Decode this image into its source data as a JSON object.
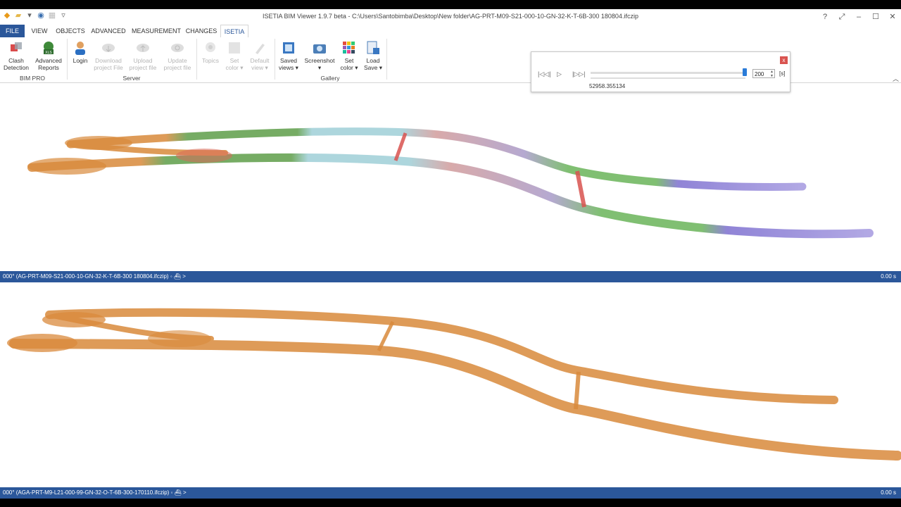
{
  "app": {
    "title": "ISETIA BIM Viewer 1.9.7 beta - C:\\Users\\Santobimba\\Desktop\\New folder\\AG-PRT-M09-S21-000-10-GN-32-K-T-6B-300 180804.ifczip",
    "window_buttons": [
      "?",
      "⤢",
      "–",
      "☐",
      "✕"
    ]
  },
  "tabs": [
    "FILE",
    "VIEW",
    "OBJECTS",
    "ADVANCED",
    "MEASUREMENT",
    "CHANGES",
    "ISETIA"
  ],
  "ribbon": {
    "groups": [
      "BIM PRO",
      "Server",
      "Gallery"
    ],
    "buttons": {
      "clash_detection": "Clash\nDetection",
      "advanced_reports": "Advanced\nReports",
      "login": "Login",
      "download_project_file": "Download\nproject File",
      "upload_project_file": "Upload\nproject file",
      "update_project_file": "Update\nproject file",
      "topics": "Topics",
      "set_color_disabled": "Set\ncolor ▾",
      "default_view": "Default\nview ▾",
      "saved_views": "Saved\nviews ▾",
      "screenshot": "Screenshot\n▾",
      "set_color": "Set\ncolor ▾",
      "load_save": "Load\nSave ▾"
    }
  },
  "player": {
    "close": "x",
    "value": "200",
    "unit": "[s]",
    "time": "52958.355134",
    "position_fraction": 1.0
  },
  "viewports": [
    {
      "status_left": "000° (AG-PRT-M09-S21-000-10-GN-32-K-T-6B-300 180804.ifczip)",
      "status_sep": "◦  ⛴ >",
      "status_right": "0.00 s"
    },
    {
      "status_left": "000° (AGA-PRT-M9-L21-000-99-GN-32-O-T-6B-300-170110.ifczip)",
      "status_sep": "◦  ⛴ >",
      "status_right": "0.00 s"
    }
  ],
  "colors": {
    "brand_blue": "#2b579a",
    "orange": "#d98a3c",
    "green": "#4f9a3a",
    "cyan": "#8fc6d0",
    "purple": "#9b8cc9",
    "red": "#d9534f"
  }
}
